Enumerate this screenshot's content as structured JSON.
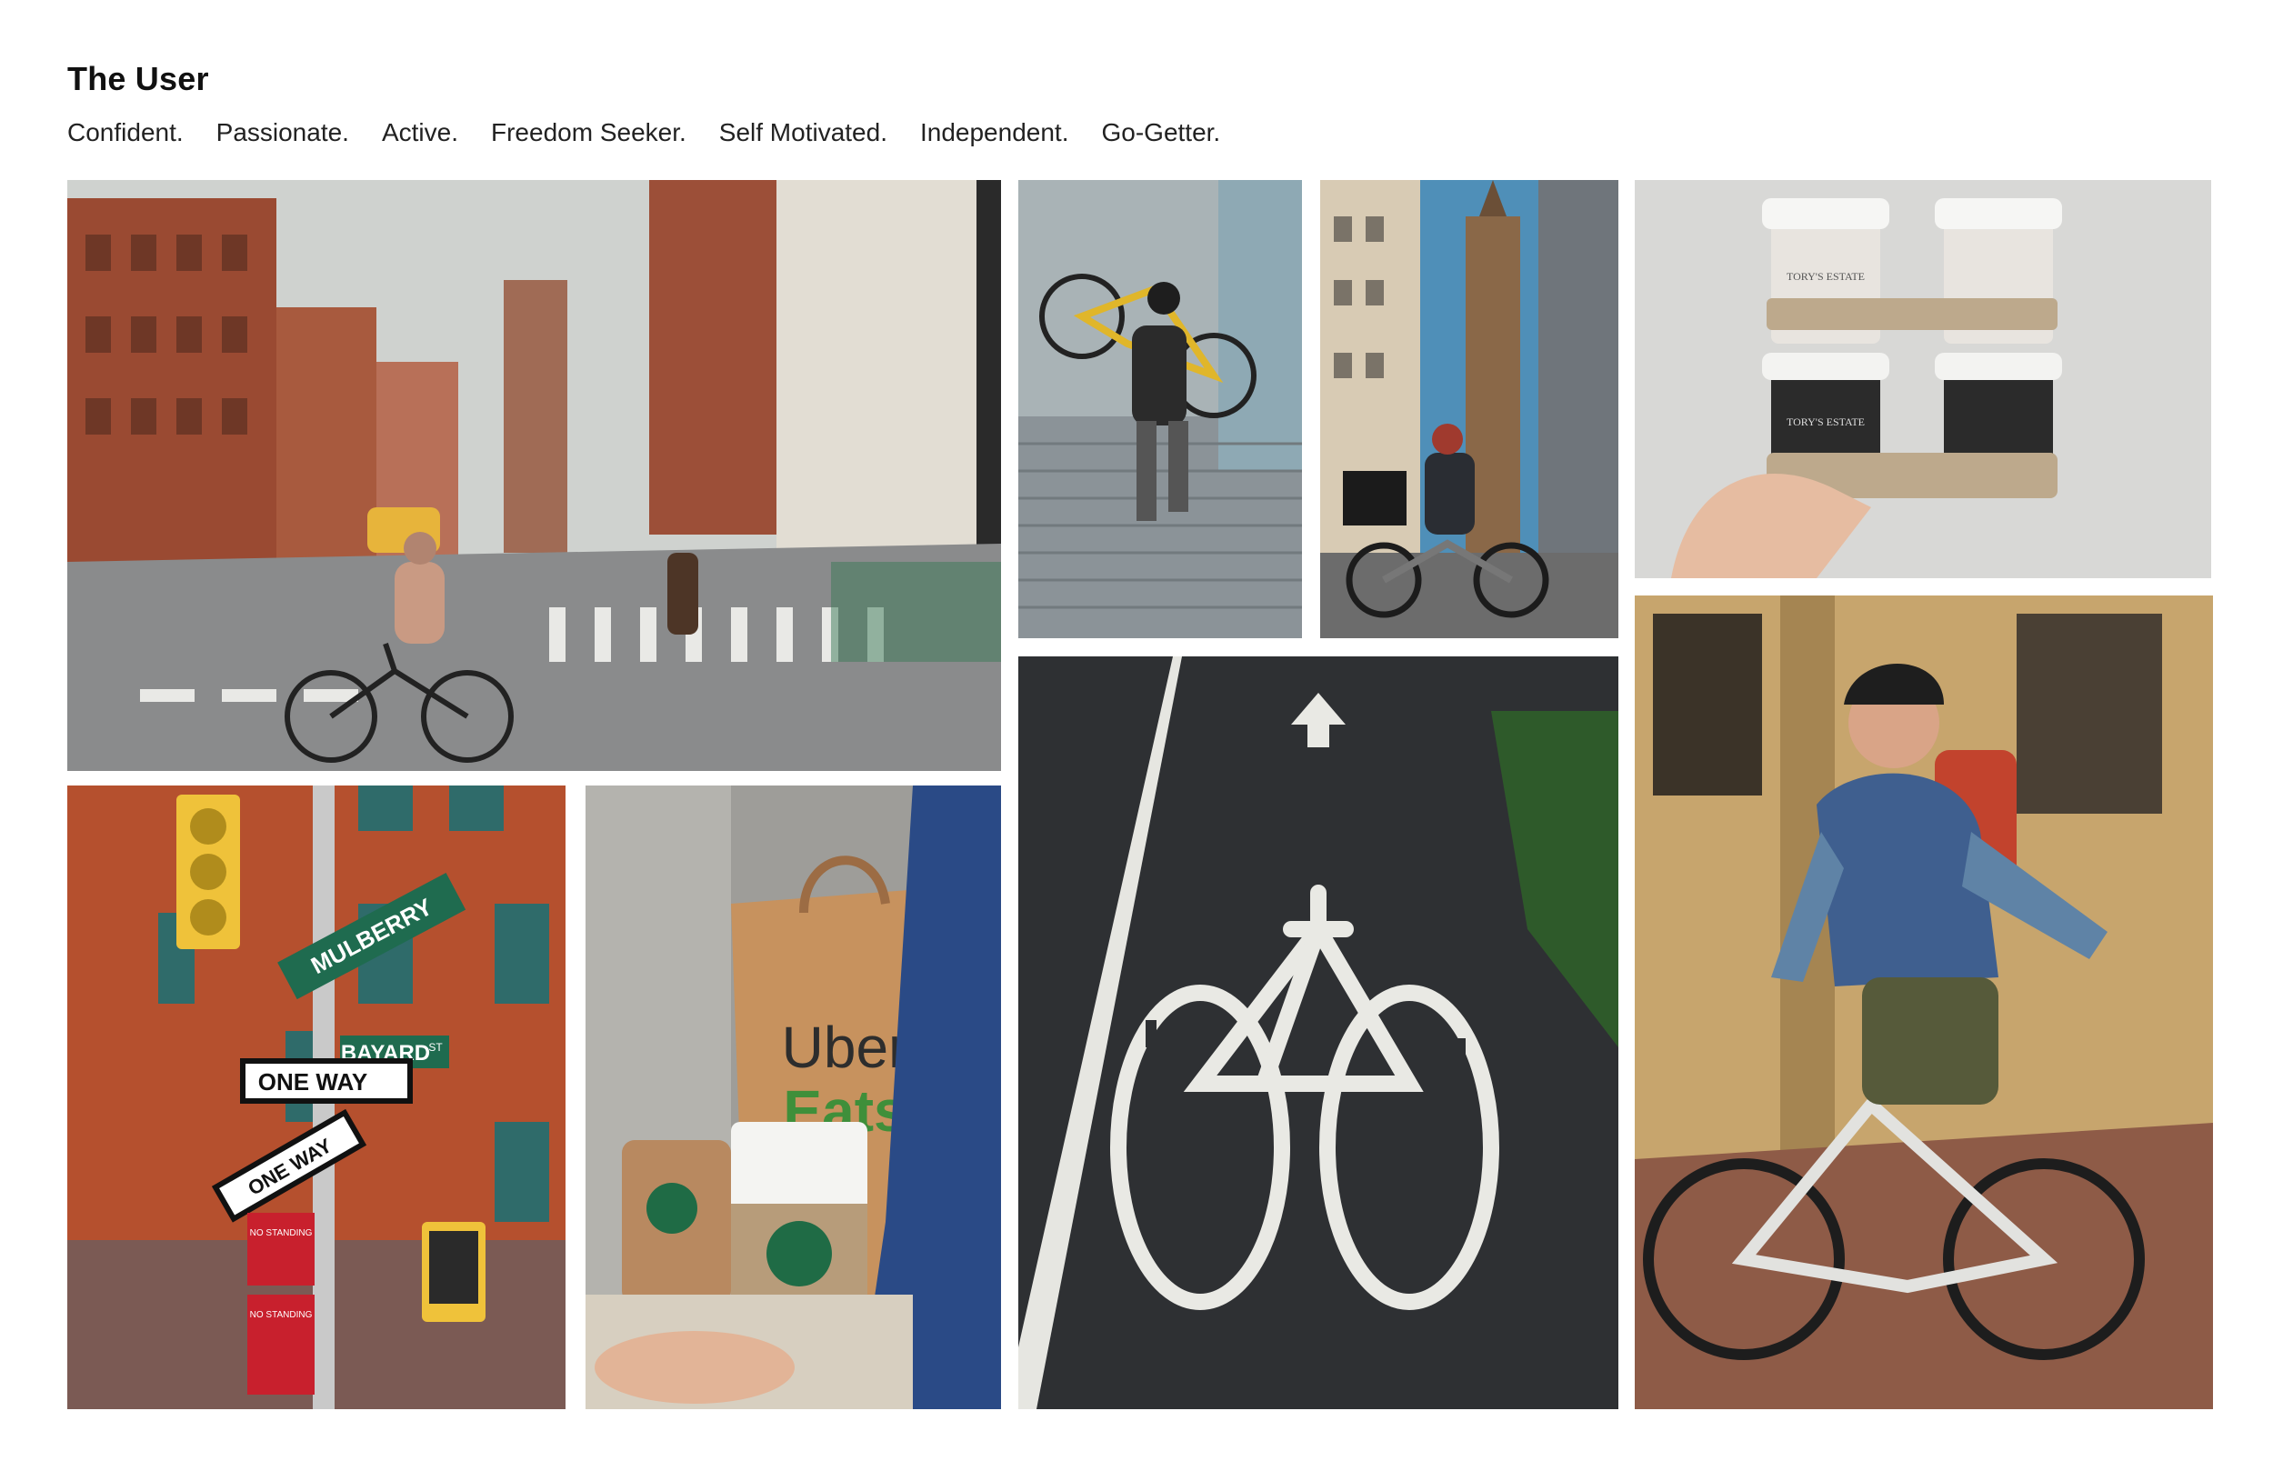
{
  "header": {
    "title": "The User",
    "traits": [
      "Confident.",
      "Passionate.",
      "Active.",
      "Freedom Seeker.",
      "Self Motivated.",
      "Independent.",
      "Go-Getter."
    ]
  },
  "photos": {
    "street_signs": {
      "sign_mulberry": "MULBERRY",
      "sign_bayard": "BAYARD",
      "sign_st": "ST",
      "one_way_1": "ONE WAY",
      "one_way_2": "ONE WAY",
      "no_standing_1": "NO STANDING",
      "no_standing_2": "NO STANDING"
    },
    "delivery_bag": {
      "brand_line1": "Uber",
      "brand_line2": "Eats"
    },
    "coffee_tray": {
      "cup_label": "TORY'S ESTATE"
    }
  },
  "colors": {
    "brick": "#b5502e",
    "uber_green": "#3f8f3a",
    "asphalt": "#2e3033",
    "sky": "#cfd2cf"
  }
}
